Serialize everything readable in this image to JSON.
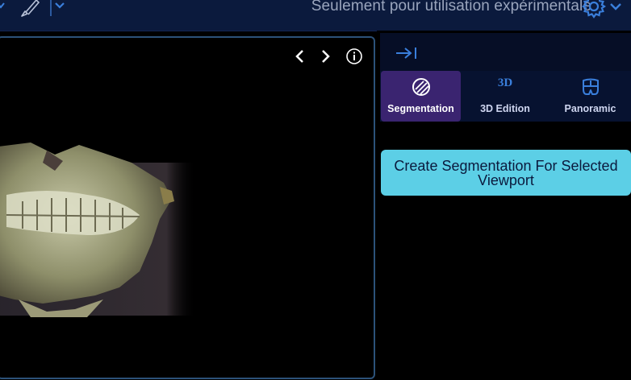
{
  "header": {
    "title": "Seulement pour utilisation expérimentale",
    "icons": [
      "brush-icon",
      "chevron-down-icon",
      "settings-gear-icon",
      "chevron-down-icon"
    ]
  },
  "viewport": {
    "nav_icons": [
      "chevron-left-icon",
      "chevron-right-icon",
      "info-icon"
    ],
    "image": "3d-dental-volume-render"
  },
  "panel": {
    "collapse_icon": "collapse-panel-icon",
    "tabs": [
      {
        "label": "Segmentation",
        "icon": "segmentation-icon",
        "active": true
      },
      {
        "label": "3D Edition",
        "icon_text": "3D",
        "active": false
      },
      {
        "label": "Panoramic",
        "icon": "panoramic-icon",
        "active": false
      }
    ],
    "create_button": "Create Segmentation For Selected Viewport"
  },
  "colors": {
    "topbar": "#0b1a3d",
    "accent_cyan": "#5ccfe6",
    "active_tab": "#3a2470",
    "icon_blue": "#3a7fdc"
  }
}
